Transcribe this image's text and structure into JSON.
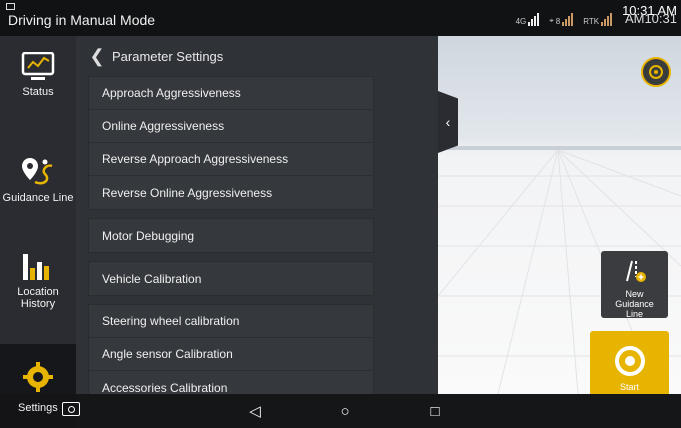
{
  "statusbar": {
    "title": "Driving in Manual Mode",
    "signal_4g": "4G",
    "sat_count": "8",
    "rtk_label": "RTK",
    "time_front": "10:31 AM",
    "time_back": "AM10:31"
  },
  "sidebar": {
    "items": [
      {
        "label": "Status",
        "icon": "monitor-chart-icon"
      },
      {
        "label": "Guidance Line",
        "icon": "route-pin-icon"
      },
      {
        "label": "Location History",
        "icon": "bar-chart-icon"
      },
      {
        "label": "Settings",
        "icon": "gear-icon"
      }
    ],
    "active": "Settings"
  },
  "panel": {
    "title": "Parameter Settings",
    "group1": [
      "Approach Aggressiveness",
      "Online Aggressiveness",
      "Reverse Approach Aggressiveness",
      "Reverse Online Aggressiveness"
    ],
    "motor": "Motor Debugging",
    "vehicle": "Vehicle Calibration",
    "group2": [
      "Steering wheel calibration",
      "Angle sensor Calibration",
      "Accessories Calibration"
    ]
  },
  "map": {
    "new_guidance_line": "New Guidance Line",
    "start": "Start"
  },
  "colors": {
    "accent": "#e7b402",
    "panel": "#2f3237",
    "sidebar": "#2a2c31"
  }
}
